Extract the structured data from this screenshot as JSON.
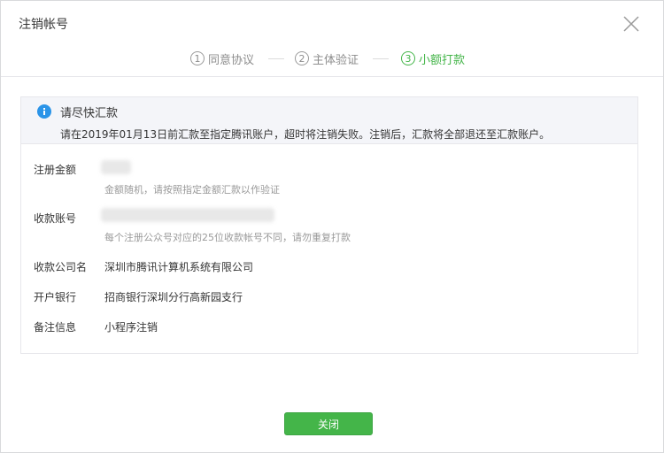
{
  "dialog": {
    "title": "注销帐号"
  },
  "steps": [
    {
      "num": "1",
      "label": "同意协议",
      "active": false
    },
    {
      "num": "2",
      "label": "主体验证",
      "active": false
    },
    {
      "num": "3",
      "label": "小额打款",
      "active": true
    }
  ],
  "notice": {
    "title": "请尽快汇款",
    "body": "请在2019年01月13日前汇款至指定腾讯账户，超时将注销失败。注销后，汇款将全部退还至汇款账户。"
  },
  "fields": {
    "amount": {
      "label": "注册金额",
      "tip": "金额随机，请按照指定金额汇款以作验证"
    },
    "account": {
      "label": "收款账号",
      "tip": "每个注册公众号对应的25位收款帐号不同，请勿重复打款"
    },
    "company": {
      "label": "收款公司名",
      "value": "深圳市腾讯计算机系统有限公司"
    },
    "bank": {
      "label": "开户银行",
      "value": "招商银行深圳分行高新园支行"
    },
    "memo": {
      "label": "备注信息",
      "value": "小程序注销"
    }
  },
  "footer": {
    "close_label": "关闭"
  },
  "colors": {
    "accent": "#44b549",
    "info": "#1aad19",
    "info_blue": "#2b94e8"
  },
  "icons": [
    "close-icon",
    "info-icon"
  ]
}
